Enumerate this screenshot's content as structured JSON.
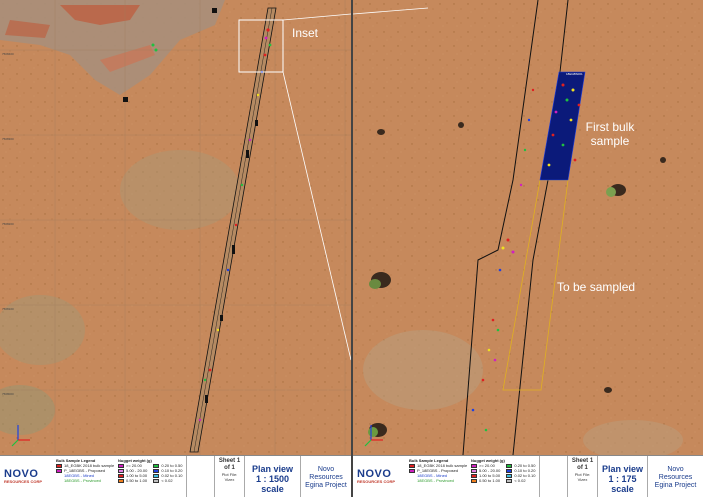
{
  "left": {
    "inset_label": "Inset",
    "coord_labels": [
      "7508400",
      "7508300",
      "7508200",
      "7508100",
      "7508000"
    ],
    "legend": {
      "logo": "NOVO",
      "logo_sub": "RESOURCES CORP",
      "bulk_title": "Bulk Sample Legend",
      "bulk_items": [
        "18_EGBK 2018 bulk sample",
        "P_18EGBS - Proposed",
        "18EGBS - Mined",
        "18EGBS - Provinced"
      ],
      "nugget_title": "Nugget weight (g)",
      "nugget_items": [
        ">= 20.00",
        "5.00 - 20.00",
        "1.00 to 5.00",
        "0.50 to 1.00",
        "0.20 to 0.50",
        "0.10 to 0.20",
        "0.02 to 0.10",
        "< 0.02"
      ],
      "sheet": "Sheet 1 of 1",
      "plot_file": "Plot File: Vizex",
      "plan_title": "Plan view",
      "scale": "1 : 1500 scale",
      "company": "Novo Resources",
      "project": "Egina Project"
    }
  },
  "right": {
    "first_bulk_label": "First bulk sample",
    "to_be_sampled_label": "To be sampled",
    "box_label": "18EGBS001",
    "legend": {
      "logo": "NOVO",
      "logo_sub": "RESOURCES CORP",
      "bulk_title": "Bulk Sample Legend",
      "bulk_items": [
        "18_EGBK 2018 bulk sample",
        "P_18EGBS - Proposed",
        "18EGBS - Mined",
        "18EGBS - Provinced"
      ],
      "nugget_title": "Nugget weight (g)",
      "nugget_items": [
        ">= 20.00",
        "5.00 - 20.00",
        "1.00 to 5.00",
        "0.50 to 1.00",
        "0.20 to 0.50",
        "0.10 to 0.20",
        "0.02 to 0.10",
        "< 0.02"
      ],
      "sheet": "Sheet 1 of 1",
      "plot_file": "Plot File: Vizex",
      "plan_title": "Plan view",
      "scale": "1 : 175 scale",
      "company": "Novo Resources",
      "project": "Egina Project"
    }
  },
  "colors": {
    "ground": "#c6895c",
    "bulk_blue": "#0b1a7a",
    "proposed": "#e0b020",
    "dot_red": "#e02020",
    "dot_magenta": "#d020c0",
    "dot_yellow": "#f0e020",
    "dot_green": "#20c040",
    "dot_blue": "#2040e0"
  }
}
